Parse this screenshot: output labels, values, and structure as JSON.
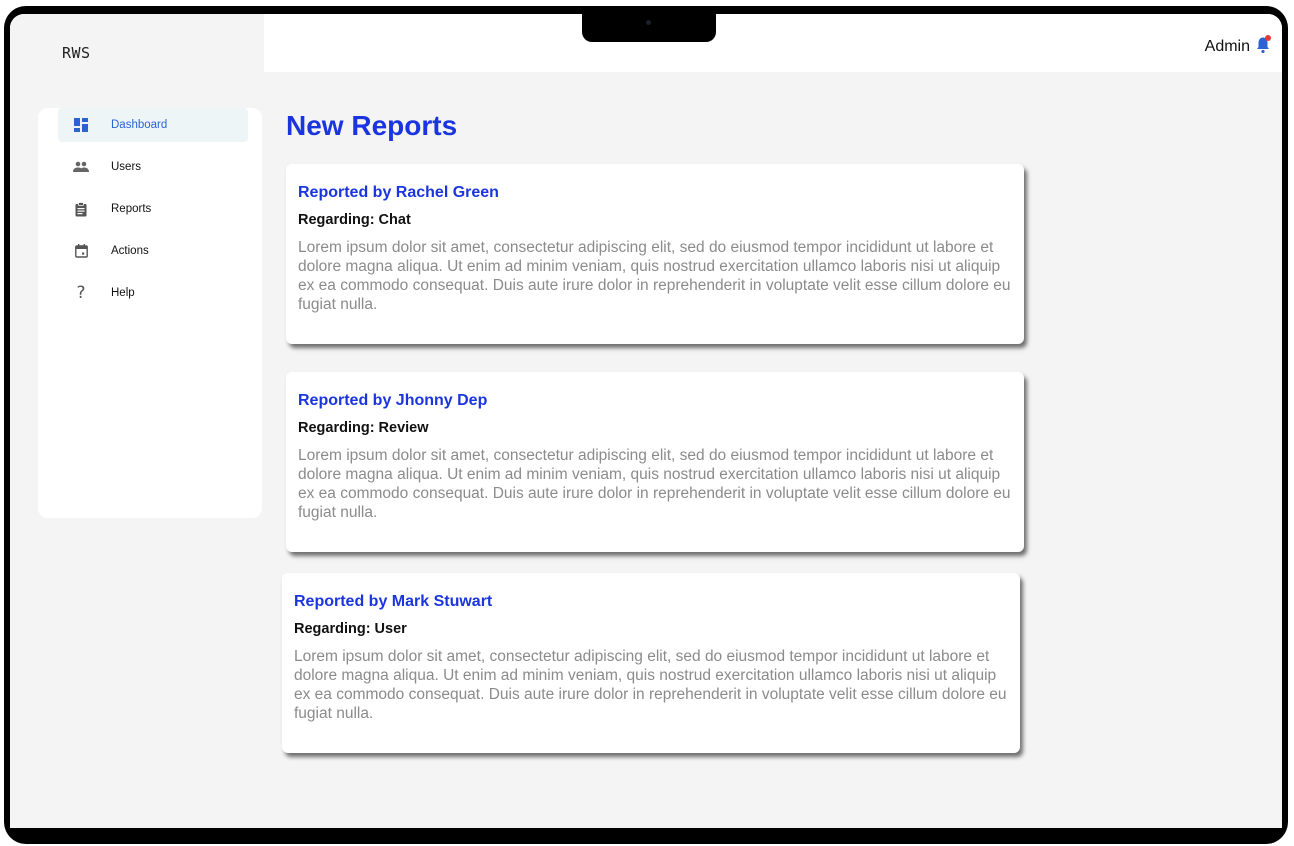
{
  "app": {
    "brand": "RWS",
    "user_label": "Admin"
  },
  "sidebar": {
    "items": [
      {
        "label": "Dashboard",
        "icon": "dashboard-icon",
        "active": true
      },
      {
        "label": "Users",
        "icon": "users-icon",
        "active": false
      },
      {
        "label": "Reports",
        "icon": "clipboard-icon",
        "active": false
      },
      {
        "label": "Actions",
        "icon": "calendar-icon",
        "active": false
      },
      {
        "label": "Help",
        "icon": "question-icon",
        "active": false
      }
    ]
  },
  "main": {
    "title": "New Reports",
    "reports": [
      {
        "reporter": "Reported by Rachel Green",
        "regarding": "Regarding: Chat",
        "body": "Lorem ipsum dolor sit amet, consectetur adipiscing elit, sed do eiusmod tempor incididunt ut labore et dolore magna aliqua. Ut enim ad minim veniam, quis nostrud exercitation ullamco laboris nisi ut aliquip ex ea commodo consequat. Duis aute irure dolor in reprehenderit in voluptate velit esse cillum dolore eu fugiat nulla."
      },
      {
        "reporter": "Reported by Jhonny Dep",
        "regarding": "Regarding: Review",
        "body": "Lorem ipsum dolor sit amet, consectetur adipiscing elit, sed do eiusmod tempor incididunt ut labore et dolore magna aliqua. Ut enim ad minim veniam, quis nostrud exercitation ullamco laboris nisi ut aliquip ex ea commodo consequat. Duis aute irure dolor in reprehenderit in voluptate velit esse cillum dolore eu fugiat nulla."
      },
      {
        "reporter": "Reported by Mark Stuwart",
        "regarding": "Regarding: User",
        "body": "Lorem ipsum dolor sit amet, consectetur adipiscing elit, sed do eiusmod tempor incididunt ut labore et dolore magna aliqua. Ut enim ad minim veniam, quis nostrud exercitation ullamco laboris nisi ut aliquip ex ea commodo consequat. Duis aute irure dolor in reprehenderit in voluptate velit esse cillum dolore eu fugiat nulla."
      }
    ]
  },
  "colors": {
    "accent": "#1a35e0",
    "active_nav": "#2b63d6",
    "notification": "#e53935"
  }
}
